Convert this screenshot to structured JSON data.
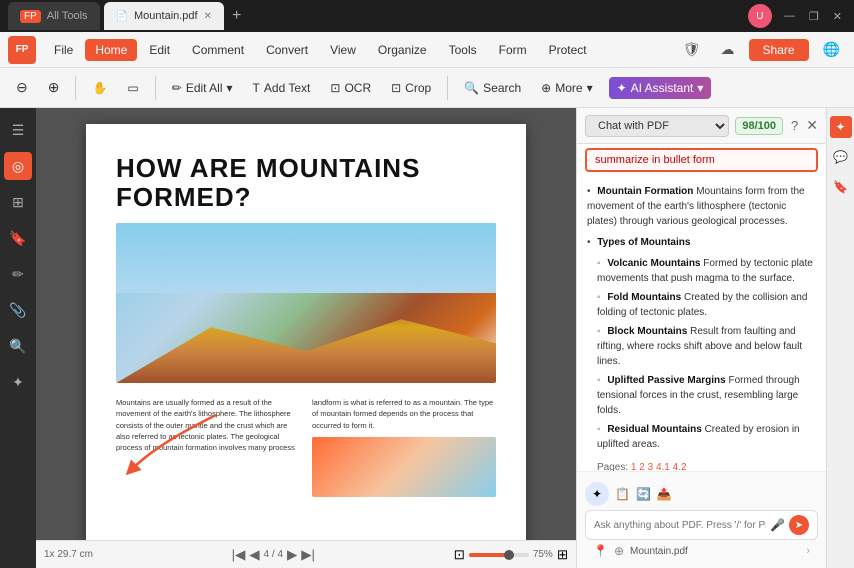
{
  "titlebar": {
    "app_name": "All Tools",
    "tab_active": "Mountain.pdf",
    "tab_add": "+",
    "logo_text": "FP",
    "win_btns": [
      "—",
      "❐",
      "✕"
    ]
  },
  "menubar": {
    "logo": "FP",
    "items": [
      "File",
      "Home",
      "Edit",
      "Comment",
      "Convert",
      "View",
      "Organize",
      "Tools",
      "Form",
      "Protect"
    ],
    "active_item": "Home",
    "share_label": "Share"
  },
  "toolbar": {
    "zoom_out": "⊖",
    "zoom_in": "⊕",
    "edit_all": "Edit All",
    "add_text": "Add Text",
    "ocr": "OCR",
    "crop": "Crop",
    "search": "Search",
    "more": "More",
    "ai_assistant": "AI Assistant"
  },
  "left_sidebar": {
    "icons": [
      "☰",
      "◎",
      "⊞",
      "⊡",
      "✏",
      "✦",
      "⊗"
    ]
  },
  "pdf": {
    "title": "HOW ARE MOUNTAINS FORMED?",
    "body_col1": "Mountains are usually formed as a result of the movement of the earth's lithosphere. The lithosphere consists of the outer mantle and the crust which are also referred to as tectonic plates. The geological process of mountain formation involves many process",
    "body_col2": "landform is what is referred to as a mountain. The type of mountain formed depends on the process that occurred to form it."
  },
  "ai_panel": {
    "title": "Chat with PDF",
    "score": "98/100",
    "search_input": "summarize in bullet form",
    "help_icon": "?",
    "close_icon": "✕",
    "response": {
      "bullets": [
        {
          "title": "Mountain Formation",
          "text": "Mountains form from the movement of the earth's lithosphere (tectonic plates) through various geological processes."
        },
        {
          "title": "Types of Mountains",
          "sub_bullets": [
            {
              "title": "Volcanic Mountains",
              "text": "Formed by tectonic plate movements that push magma to the surface."
            },
            {
              "title": "Fold Mountains",
              "text": "Created by the collision and folding of tectonic plates."
            },
            {
              "title": "Block Mountains",
              "text": "Result from faulting and rifting, where rocks shift above and below fault lines."
            },
            {
              "title": "Uplifted Passive Margins",
              "text": "Formed through tensional forces in the crust, resembling large folds."
            },
            {
              "title": "Residual Mountains",
              "text": "Created by erosion in uplifted areas."
            }
          ]
        }
      ],
      "page_refs_label": "Pages:",
      "page_refs": [
        "1",
        "2",
        "3",
        "4.1",
        "4.2"
      ]
    },
    "chat_placeholder": "Ask anything about PDF. Press '/' for Prompts.",
    "file_name": "Mountain.pdf",
    "chat_footer_icons": [
      "📍",
      "⊕"
    ]
  },
  "statusbar": {
    "dimensions": "1x 29.7 cm",
    "page_nav": "4 / 4",
    "zoom": "75%"
  }
}
